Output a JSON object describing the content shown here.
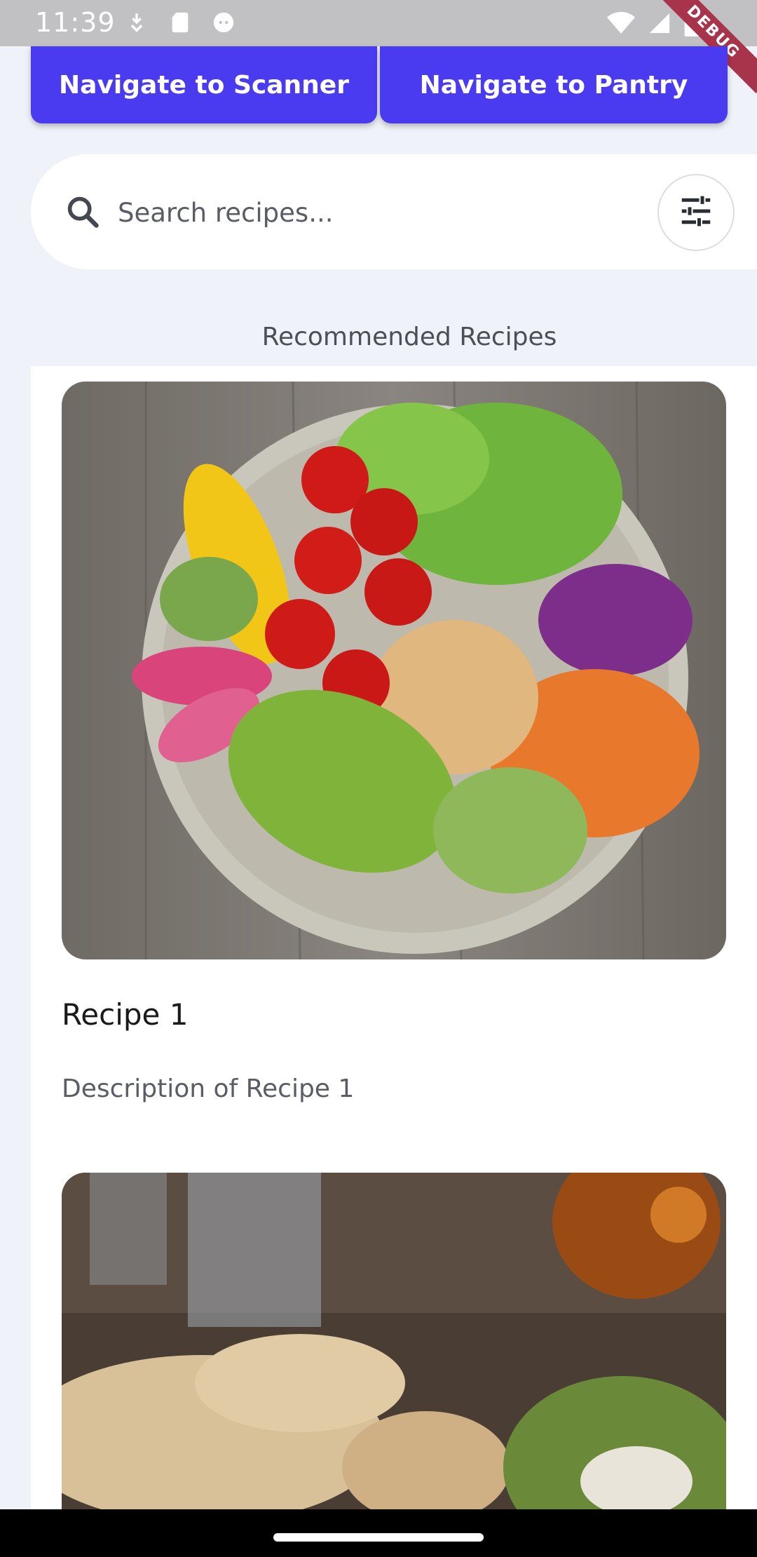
{
  "status_bar": {
    "time": "11:39",
    "debug_label": "DEBUG"
  },
  "nav": {
    "scanner_label": "Navigate to Scanner",
    "pantry_label": "Navigate to Pantry"
  },
  "search": {
    "placeholder": "Search recipes...",
    "value": ""
  },
  "section": {
    "title": "Recommended Recipes"
  },
  "recipes": [
    {
      "title": "Recipe 1",
      "description": "Description of Recipe 1",
      "image": "salad-bowl-photo"
    },
    {
      "title": "",
      "description": "",
      "image": "pastry-dinner-photo"
    }
  ],
  "colors": {
    "primary": "#4a3af0",
    "background": "#eff2f8",
    "status_bar": "#c1c1c3",
    "debug_banner": "#a8344c"
  }
}
